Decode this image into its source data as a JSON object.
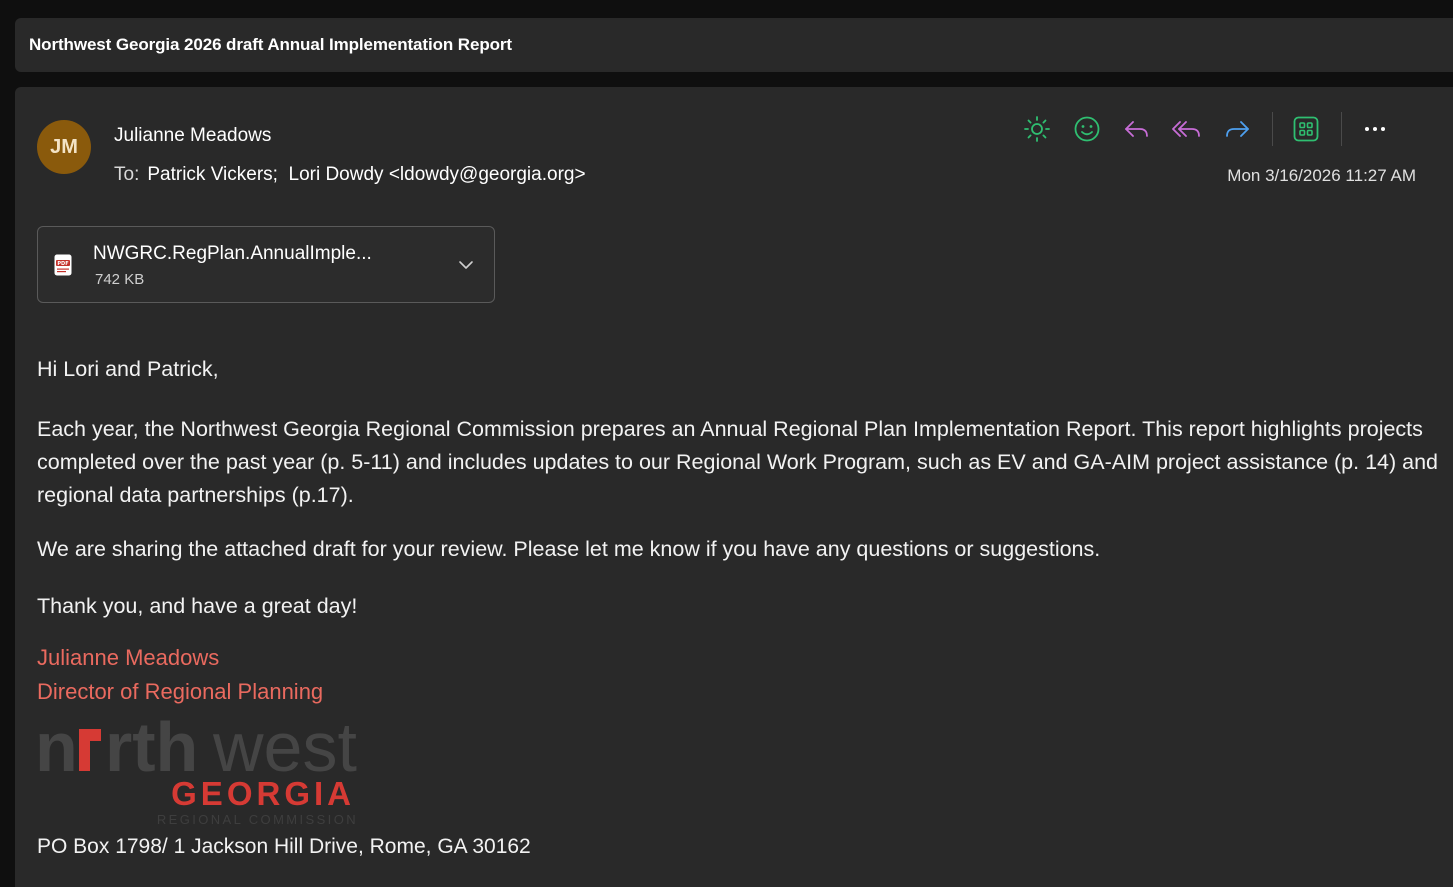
{
  "subject": "Northwest Georgia 2026 draft Annual Implementation Report",
  "sender": {
    "initials": "JM",
    "name": "Julianne Meadows",
    "avatar_color": "#8a5a0c"
  },
  "recipients": {
    "to_label": "To:",
    "list": [
      "Patrick Vickers;",
      "Lori Dowdy <ldowdy@georgia.org>"
    ]
  },
  "timestamp": "Mon 3/16/2026 11:27 AM",
  "toolbar": {
    "items": [
      {
        "icon": "sun-icon",
        "color": "#2fbf71"
      },
      {
        "icon": "smiley-icon",
        "color": "#2fbf71"
      },
      {
        "icon": "reply-icon",
        "color": "#c86dd7"
      },
      {
        "icon": "reply-all-icon",
        "color": "#c86dd7"
      },
      {
        "icon": "forward-icon",
        "color": "#4ea0f0"
      },
      {
        "icon": "apps-icon",
        "color": "#2fbf71"
      },
      {
        "icon": "more-icon",
        "color": "#ffffff"
      }
    ]
  },
  "attachment": {
    "name": "NWGRC.RegPlan.AnnualImple...",
    "size": "742 KB",
    "type_label": "PDF"
  },
  "body": {
    "greeting": "Hi Lori and Patrick,",
    "paragraph1": "Each year, the Northwest Georgia Regional Commission prepares an Annual Regional Plan Implementation Report. This report highlights projects completed over the past year (p. 5-11) and includes updates to our Regional Work Program, such as EV and GA-AIM project assistance (p. 14) and regional data partnerships (p.17).",
    "paragraph2": "We are sharing the attached draft for your review. Please let me know if you have any questions or suggestions.",
    "closing": "Thank you, and have a great day!"
  },
  "signature": {
    "name": "Julianne Meadows",
    "title": "Director of Regional Planning",
    "logo_word1": "rth",
    "logo_word2": "west",
    "logo_word3": "GEORGIA",
    "logo_word4": "REGIONAL COMMISSION",
    "address": "PO Box 1798/ 1 Jackson Hill Drive, Rome, GA 30162"
  }
}
